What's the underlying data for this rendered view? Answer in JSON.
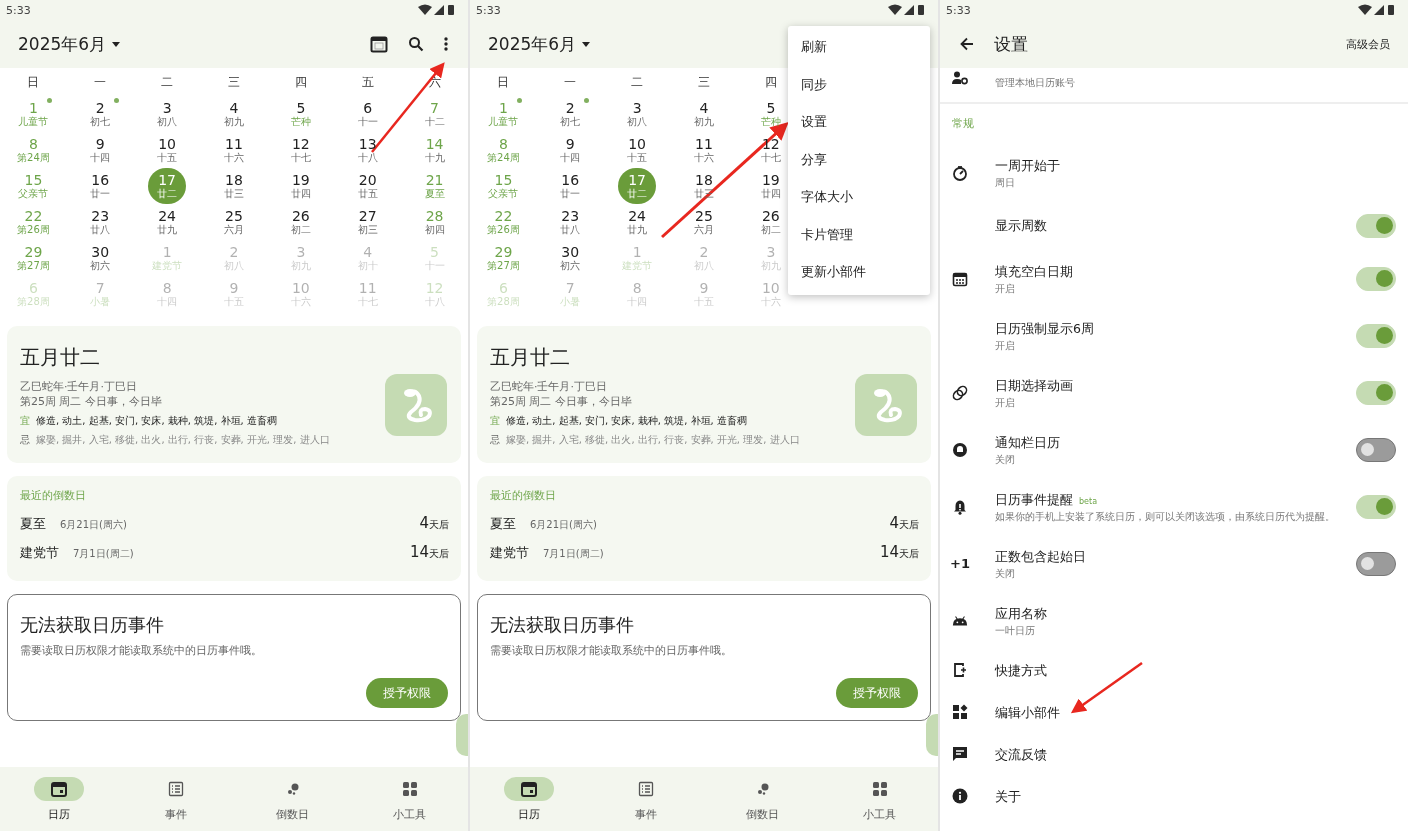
{
  "screens": [
    {
      "kind": "calendar",
      "status_time": "5:33",
      "month_title": "2025年6月",
      "weekdays": [
        "日",
        "一",
        "二",
        "三",
        "四",
        "五",
        "六"
      ],
      "weeks": [
        [
          {
            "day": "1",
            "sub": "儿童节",
            "festival": true,
            "outside": false,
            "selected": false,
            "dot": true
          },
          {
            "day": "2",
            "sub": "初七",
            "festival": false,
            "outside": false,
            "selected": false,
            "dot": true
          },
          {
            "day": "3",
            "sub": "初八",
            "festival": false,
            "outside": false,
            "selected": false,
            "dot": false
          },
          {
            "day": "4",
            "sub": "初九",
            "festival": false,
            "outside": false,
            "selected": false,
            "dot": false
          },
          {
            "day": "5",
            "sub": "芒种",
            "festival": true,
            "outside": false,
            "selected": false,
            "dot": false
          },
          {
            "day": "6",
            "sub": "十一",
            "festival": false,
            "outside": false,
            "selected": false,
            "dot": false
          },
          {
            "day": "7",
            "sub": "十二",
            "festival": false,
            "outside": false,
            "selected": false,
            "dot": false
          }
        ],
        [
          {
            "day": "8",
            "sub": "第24周",
            "festival": true,
            "outside": false,
            "selected": false,
            "dot": false
          },
          {
            "day": "9",
            "sub": "十四",
            "festival": false,
            "outside": false,
            "selected": false,
            "dot": false
          },
          {
            "day": "10",
            "sub": "十五",
            "festival": false,
            "outside": false,
            "selected": false,
            "dot": false
          },
          {
            "day": "11",
            "sub": "十六",
            "festival": false,
            "outside": false,
            "selected": false,
            "dot": false
          },
          {
            "day": "12",
            "sub": "十七",
            "festival": false,
            "outside": false,
            "selected": false,
            "dot": false
          },
          {
            "day": "13",
            "sub": "十八",
            "festival": false,
            "outside": false,
            "selected": false,
            "dot": false
          },
          {
            "day": "14",
            "sub": "十九",
            "festival": false,
            "outside": false,
            "selected": false,
            "dot": false
          }
        ],
        [
          {
            "day": "15",
            "sub": "父亲节",
            "festival": true,
            "outside": false,
            "selected": false,
            "dot": false
          },
          {
            "day": "16",
            "sub": "廿一",
            "festival": false,
            "outside": false,
            "selected": false,
            "dot": false
          },
          {
            "day": "17",
            "sub": "廿二",
            "festival": false,
            "outside": false,
            "selected": true,
            "dot": false
          },
          {
            "day": "18",
            "sub": "廿三",
            "festival": false,
            "outside": false,
            "selected": false,
            "dot": false
          },
          {
            "day": "19",
            "sub": "廿四",
            "festival": false,
            "outside": false,
            "selected": false,
            "dot": false
          },
          {
            "day": "20",
            "sub": "廿五",
            "festival": false,
            "outside": false,
            "selected": false,
            "dot": false
          },
          {
            "day": "21",
            "sub": "夏至",
            "festival": true,
            "outside": false,
            "selected": false,
            "dot": false
          }
        ],
        [
          {
            "day": "22",
            "sub": "第26周",
            "festival": true,
            "outside": false,
            "selected": false,
            "dot": false
          },
          {
            "day": "23",
            "sub": "廿八",
            "festival": false,
            "outside": false,
            "selected": false,
            "dot": false
          },
          {
            "day": "24",
            "sub": "廿九",
            "festival": false,
            "outside": false,
            "selected": false,
            "dot": false
          },
          {
            "day": "25",
            "sub": "六月",
            "festival": false,
            "outside": false,
            "selected": false,
            "dot": false
          },
          {
            "day": "26",
            "sub": "初二",
            "festival": false,
            "outside": false,
            "selected": false,
            "dot": false
          },
          {
            "day": "27",
            "sub": "初三",
            "festival": false,
            "outside": false,
            "selected": false,
            "dot": false
          },
          {
            "day": "28",
            "sub": "初四",
            "festival": false,
            "outside": false,
            "selected": false,
            "dot": false
          }
        ],
        [
          {
            "day": "29",
            "sub": "第27周",
            "festival": true,
            "outside": false,
            "selected": false,
            "dot": false
          },
          {
            "day": "30",
            "sub": "初六",
            "festival": false,
            "outside": false,
            "selected": false,
            "dot": false
          },
          {
            "day": "1",
            "sub": "建党节",
            "festival": true,
            "outside": true,
            "selected": false,
            "dot": false
          },
          {
            "day": "2",
            "sub": "初八",
            "festival": false,
            "outside": true,
            "selected": false,
            "dot": false
          },
          {
            "day": "3",
            "sub": "初九",
            "festival": false,
            "outside": true,
            "selected": false,
            "dot": false
          },
          {
            "day": "4",
            "sub": "初十",
            "festival": false,
            "outside": true,
            "selected": false,
            "dot": false
          },
          {
            "day": "5",
            "sub": "十一",
            "festival": false,
            "outside": true,
            "selected": false,
            "dot": false
          }
        ],
        [
          {
            "day": "6",
            "sub": "第28周",
            "festival": true,
            "outside": true,
            "selected": false,
            "dot": false
          },
          {
            "day": "7",
            "sub": "小暑",
            "festival": true,
            "outside": true,
            "selected": false,
            "dot": false
          },
          {
            "day": "8",
            "sub": "十四",
            "festival": false,
            "outside": true,
            "selected": false,
            "dot": false
          },
          {
            "day": "9",
            "sub": "十五",
            "festival": false,
            "outside": true,
            "selected": false,
            "dot": false
          },
          {
            "day": "10",
            "sub": "十六",
            "festival": false,
            "outside": true,
            "selected": false,
            "dot": false
          },
          {
            "day": "11",
            "sub": "十七",
            "festival": false,
            "outside": true,
            "selected": false,
            "dot": false
          },
          {
            "day": "12",
            "sub": "十八",
            "festival": false,
            "outside": true,
            "selected": false,
            "dot": false
          }
        ]
      ],
      "almanac": {
        "lunar_date": "五月廿二",
        "ganzhi": "乙巳蛇年·壬午月·丁巳日",
        "week_line": "第25周 周二 今日事，今日毕",
        "good_label": "宜",
        "good": "修造, 动土, 起基, 安门, 安床, 栽种, 筑堤, 补垣, 造畜稠",
        "bad_label": "忌",
        "bad": "嫁娶, 掘井, 入宅, 移徙, 出火, 出行, 行丧, 安葬, 开光, 理发, 进人口"
      },
      "countdown": {
        "heading": "最近的倒数日",
        "items": [
          {
            "name": "夏至",
            "date": "6月21日(周六)",
            "count": "4",
            "unit": "天后"
          },
          {
            "name": "建党节",
            "date": "7月1日(周二)",
            "count": "14",
            "unit": "天后"
          }
        ]
      },
      "events_card": {
        "title": "无法获取日历事件",
        "message": "需要读取日历权限才能读取系统中的日历事件哦。",
        "button": "授予权限"
      },
      "nav": [
        {
          "label": "日历",
          "selected": true
        },
        {
          "label": "事件",
          "selected": false
        },
        {
          "label": "倒数日",
          "selected": false
        },
        {
          "label": "小工具",
          "selected": false
        }
      ]
    },
    {
      "kind": "calendar",
      "status_time": "5:33",
      "month_title": "2025年6月",
      "menu": {
        "items": [
          "刷新",
          "同步",
          "设置",
          "分享",
          "字体大小",
          "卡片管理",
          "更新小部件"
        ]
      },
      "weekdays": [
        "日",
        "一",
        "二",
        "三",
        "四"
      ],
      "weeks": [
        [
          {
            "day": "1",
            "sub": "儿童节",
            "festival": true,
            "outside": false,
            "selected": false,
            "dot": true
          },
          {
            "day": "2",
            "sub": "初七",
            "festival": false,
            "outside": false,
            "selected": false,
            "dot": true
          },
          {
            "day": "3",
            "sub": "初八",
            "festival": false,
            "outside": false,
            "selected": false,
            "dot": false
          },
          {
            "day": "4",
            "sub": "初九",
            "festival": false,
            "outside": false,
            "selected": false,
            "dot": false
          },
          {
            "day": "5",
            "sub": "芒种",
            "festival": true,
            "outside": false,
            "selected": false,
            "dot": false
          }
        ],
        [
          {
            "day": "8",
            "sub": "第24周",
            "festival": true,
            "outside": false,
            "selected": false,
            "dot": false
          },
          {
            "day": "9",
            "sub": "十四",
            "festival": false,
            "outside": false,
            "selected": false,
            "dot": false
          },
          {
            "day": "10",
            "sub": "十五",
            "festival": false,
            "outside": false,
            "selected": false,
            "dot": false
          },
          {
            "day": "11",
            "sub": "十六",
            "festival": false,
            "outside": false,
            "selected": false,
            "dot": false
          },
          {
            "day": "12",
            "sub": "十七",
            "festival": false,
            "outside": false,
            "selected": false,
            "dot": false
          }
        ],
        [
          {
            "day": "15",
            "sub": "父亲节",
            "festival": true,
            "outside": false,
            "selected": false,
            "dot": false
          },
          {
            "day": "16",
            "sub": "廿一",
            "festival": false,
            "outside": false,
            "selected": false,
            "dot": false
          },
          {
            "day": "17",
            "sub": "廿二",
            "festival": false,
            "outside": false,
            "selected": true,
            "dot": false
          },
          {
            "day": "18",
            "sub": "廿三",
            "festival": false,
            "outside": false,
            "selected": false,
            "dot": false
          },
          {
            "day": "19",
            "sub": "廿四",
            "festival": false,
            "outside": false,
            "selected": false,
            "dot": false
          }
        ],
        [
          {
            "day": "22",
            "sub": "第26周",
            "festival": true,
            "outside": false,
            "selected": false,
            "dot": false
          },
          {
            "day": "23",
            "sub": "廿八",
            "festival": false,
            "outside": false,
            "selected": false,
            "dot": false
          },
          {
            "day": "24",
            "sub": "廿九",
            "festival": false,
            "outside": false,
            "selected": false,
            "dot": false
          },
          {
            "day": "25",
            "sub": "六月",
            "festival": false,
            "outside": false,
            "selected": false,
            "dot": false
          },
          {
            "day": "26",
            "sub": "初二",
            "festival": false,
            "outside": false,
            "selected": false,
            "dot": false
          }
        ],
        [
          {
            "day": "29",
            "sub": "第27周",
            "festival": true,
            "outside": false,
            "selected": false,
            "dot": false
          },
          {
            "day": "30",
            "sub": "初六",
            "festival": false,
            "outside": false,
            "selected": false,
            "dot": false
          },
          {
            "day": "1",
            "sub": "建党节",
            "festival": true,
            "outside": true,
            "selected": false,
            "dot": false
          },
          {
            "day": "2",
            "sub": "初八",
            "festival": false,
            "outside": true,
            "selected": false,
            "dot": false
          },
          {
            "day": "3",
            "sub": "初九",
            "festival": false,
            "outside": true,
            "selected": false,
            "dot": false
          }
        ],
        [
          {
            "day": "6",
            "sub": "第28周",
            "festival": true,
            "outside": true,
            "selected": false,
            "dot": false
          },
          {
            "day": "7",
            "sub": "小暑",
            "festival": true,
            "outside": true,
            "selected": false,
            "dot": false
          },
          {
            "day": "8",
            "sub": "十四",
            "festival": false,
            "outside": true,
            "selected": false,
            "dot": false
          },
          {
            "day": "9",
            "sub": "十五",
            "festival": false,
            "outside": true,
            "selected": false,
            "dot": false
          },
          {
            "day": "10",
            "sub": "十六",
            "festival": false,
            "outside": true,
            "selected": false,
            "dot": false
          }
        ]
      ],
      "almanac": {
        "lunar_date": "五月廿二",
        "ganzhi": "乙巳蛇年·壬午月·丁巳日",
        "week_line": "第25周 周二 今日事，今日毕",
        "good_label": "宜",
        "good": "修造, 动土, 起基, 安门, 安床, 栽种, 筑堤, 补垣, 造畜稠",
        "bad_label": "忌",
        "bad": "嫁娶, 掘井, 入宅, 移徙, 出火, 出行, 行丧, 安葬, 开光, 理发, 进人口"
      },
      "countdown": {
        "heading": "最近的倒数日",
        "items": [
          {
            "name": "夏至",
            "date": "6月21日(周六)",
            "count": "4",
            "unit": "天后"
          },
          {
            "name": "建党节",
            "date": "7月1日(周二)",
            "count": "14",
            "unit": "天后"
          }
        ]
      },
      "events_card": {
        "title": "无法获取日历事件",
        "message": "需要读取日历权限才能读取系统中的日历事件哦。",
        "button": "授予权限"
      },
      "nav": [
        {
          "label": "日历",
          "selected": true
        },
        {
          "label": "事件",
          "selected": false
        },
        {
          "label": "倒数日",
          "selected": false
        },
        {
          "label": "小工具",
          "selected": false
        }
      ]
    },
    {
      "kind": "settings",
      "status_time": "5:33",
      "title": "设置",
      "action": "高级会员",
      "partial_item_subtitle": "管理本地日历账号",
      "section": "常规",
      "items": [
        {
          "kind": "value",
          "title": "一周开始于",
          "subtitle": "周日"
        },
        {
          "kind": "toggle",
          "title": "显示周数",
          "on": true
        },
        {
          "kind": "toggle",
          "title": "填充空白日期",
          "subtitle": "开启",
          "on": true
        },
        {
          "kind": "toggle",
          "title": "日历强制显示6周",
          "subtitle": "开启",
          "on": true
        },
        {
          "kind": "toggle",
          "title": "日期选择动画",
          "subtitle": "开启",
          "on": true
        },
        {
          "kind": "toggle",
          "title": "通知栏日历",
          "subtitle": "关闭",
          "on": false
        },
        {
          "kind": "toggle",
          "title": "日历事件提醒",
          "tag": "beta",
          "subtitle": "如果你的手机上安装了系统日历，则可以关闭该选项，由系统日历代为提醒。",
          "on": true
        },
        {
          "kind": "toggle",
          "title": "正数包含起始日",
          "icon_text": "+1",
          "subtitle": "关闭",
          "on": false
        },
        {
          "kind": "value",
          "title": "应用名称",
          "subtitle": "一叶日历"
        },
        {
          "kind": "link",
          "title": "快捷方式"
        },
        {
          "kind": "link",
          "title": "编辑小部件"
        },
        {
          "kind": "link",
          "title": "交流反馈"
        },
        {
          "kind": "link",
          "title": "关于"
        }
      ]
    }
  ]
}
